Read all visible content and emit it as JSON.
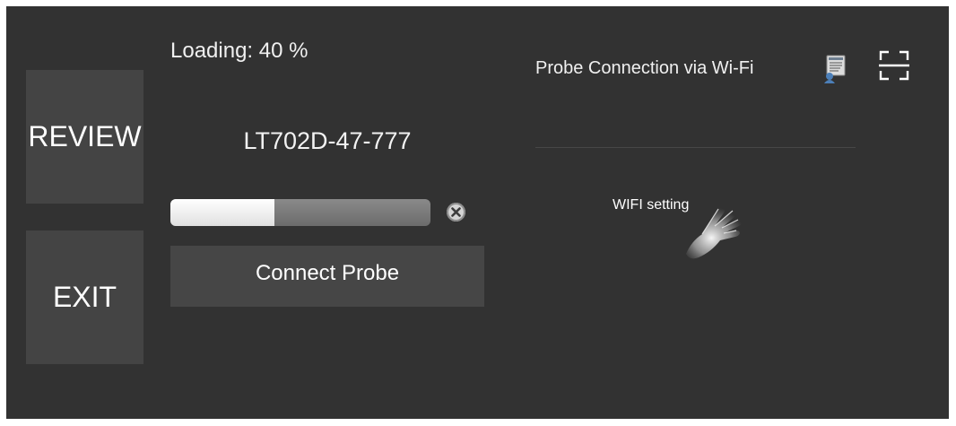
{
  "sidebar": {
    "review_label": "REVIEW",
    "exit_label": "EXIT"
  },
  "loading": {
    "text": "Loading: 40 %",
    "progress_fraction": 0.4
  },
  "probe": {
    "id": "LT702D-47-777",
    "connect_label": "Connect Probe"
  },
  "wifi_panel": {
    "title": "Probe Connection via Wi-Fi",
    "wifi_setting_label": "WIFI setting"
  },
  "icons": {
    "cancel": "cancel-circle-icon",
    "manual": "manual-book-icon",
    "scan": "scan-frame-icon",
    "hand": "pointing-hand-icon"
  },
  "colors": {
    "background": "#323232",
    "button": "#444444",
    "progress_fill": "#f2f2f2",
    "progress_track": "#7a7a7a"
  }
}
